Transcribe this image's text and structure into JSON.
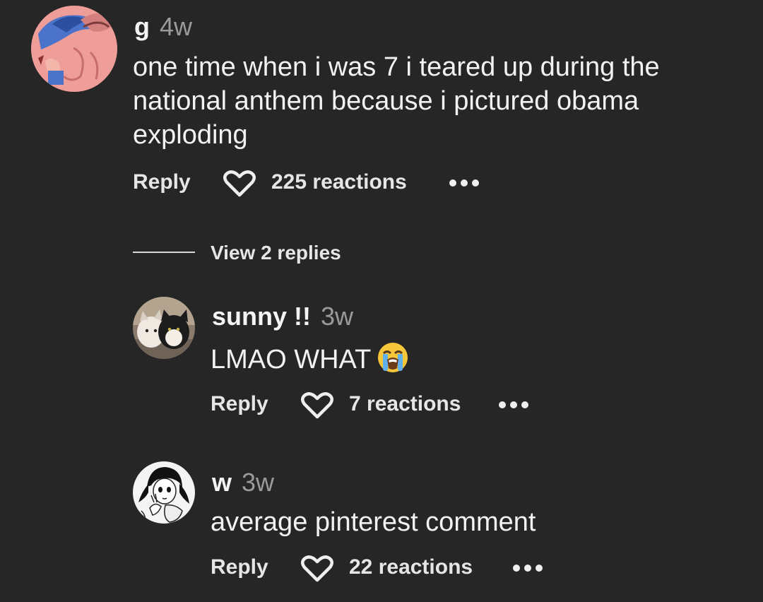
{
  "comments": [
    {
      "username": "g",
      "time": "4w",
      "text_lines": [
        "one time when i was 7 i teared up during the",
        "national anthem because i pictured obama",
        "exploding"
      ],
      "reply_label": "Reply",
      "reactions": "225 reactions",
      "avatar_icon": "cartoon-avatar-icon"
    }
  ],
  "view_replies": "View 2 replies",
  "replies": [
    {
      "username": "sunny !!",
      "time": "3w",
      "text": "LMAO WHAT",
      "emoji": "loudly-crying-face-emoji",
      "reply_label": "Reply",
      "reactions": "7 reactions",
      "avatar_icon": "cats-avatar-icon"
    },
    {
      "username": "w",
      "time": "3w",
      "text": "average pinterest comment",
      "reply_label": "Reply",
      "reactions": "22 reactions",
      "avatar_icon": "manga-avatar-icon"
    }
  ],
  "colors": {
    "background": "#262626",
    "text": "#f2f2f2",
    "muted": "#9a9a9a"
  }
}
